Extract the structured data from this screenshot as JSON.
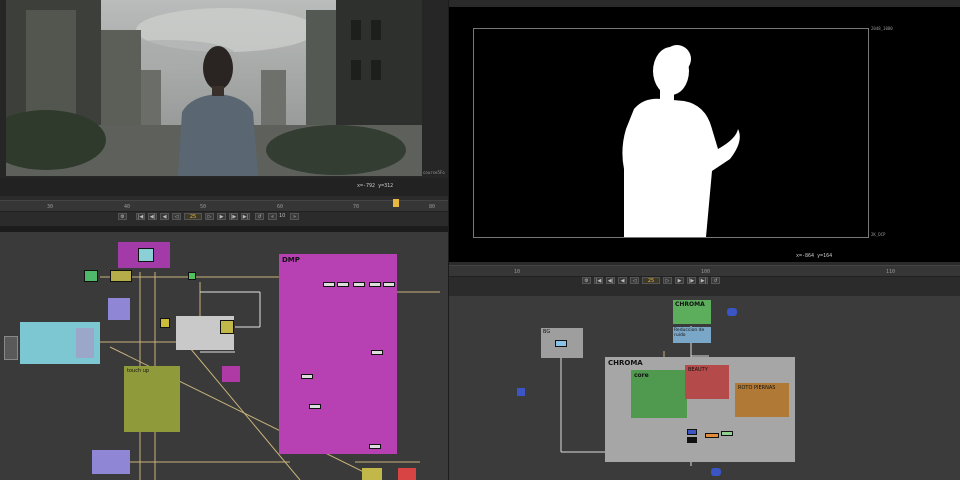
{
  "left_viewer": {
    "coords": "x=-792 y=312",
    "format_label": "course5Fo"
  },
  "left_timeline": {
    "ticks": [
      "30",
      "40",
      "50",
      "60",
      "70",
      "80"
    ],
    "current_frame": "25",
    "step_value": "10"
  },
  "right_viewer": {
    "format_top": "2048_1080",
    "format_bottom": "2K_DCP",
    "coords": "x=-864 y=164"
  },
  "right_timeline": {
    "ticks": [
      "10",
      "100",
      "110"
    ],
    "current_frame": "25"
  },
  "left_graph": {
    "dmp_label": "DMP",
    "touchup_label": "touch up"
  },
  "right_graph": {
    "chroma_top_label": "CHROMA",
    "reduction_label": "Reduccion de ruido",
    "bg_label": "BG",
    "chroma_main_label": "CHROMA",
    "core_label": "core",
    "beauty_label": "BEAUTY",
    "roto_label": "ROTO PIERNAS"
  },
  "colors": {
    "accent_orange": "#e9b640",
    "dmp_backdrop": "#b740b2",
    "chroma_backdrop": "#a6a6a6",
    "core_backdrop": "#4f9a4f",
    "beauty_backdrop": "#b54a4a",
    "roto_backdrop": "#b07a36",
    "touchup_backdrop": "#8f9a3a"
  }
}
